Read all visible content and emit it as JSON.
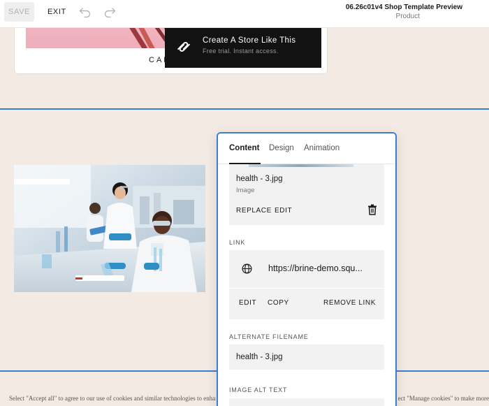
{
  "toolbar": {
    "save_label": "SAVE",
    "exit_label": "EXIT",
    "undo_icon": "undo-icon",
    "redo_icon": "redo-icon",
    "site_title": "06.26c01v4 Shop Template Preview",
    "page_type": "Product"
  },
  "product_card": {
    "caption": "CAF"
  },
  "promo": {
    "title": "Create A Store Like This",
    "subtitle": "Free trial. Instant access.",
    "logo_icon": "squarespace-logo-icon"
  },
  "panel": {
    "tabs": [
      {
        "label": "Content",
        "active": true
      },
      {
        "label": "Design",
        "active": false
      },
      {
        "label": "Animation",
        "active": false
      }
    ],
    "image": {
      "file_name": "health - 3.jpg",
      "file_type": "Image",
      "replace_label": "REPLACE",
      "edit_label": "EDIT",
      "delete_icon": "trash-icon"
    },
    "link": {
      "section_label": "LINK",
      "url": "https://brine-demo.squ...",
      "edit_label": "EDIT",
      "copy_label": "COPY",
      "remove_label": "REMOVE LINK",
      "icon": "globe-icon"
    },
    "alternate_filename": {
      "section_label": "ALTERNATE FILENAME",
      "value": "health - 3.jpg"
    },
    "alt_text": {
      "section_label": "IMAGE ALT TEXT",
      "value": ""
    }
  },
  "cookie_banner": {
    "text_left": "Select \"Accept all\" to agree to our use of cookies and similar technologies to enhar",
    "text_right": "elect \"Manage cookies\" to make more"
  },
  "colors": {
    "accent": "#3c7dd4",
    "background": "#f3ebe3",
    "promo_bg": "#121212"
  }
}
